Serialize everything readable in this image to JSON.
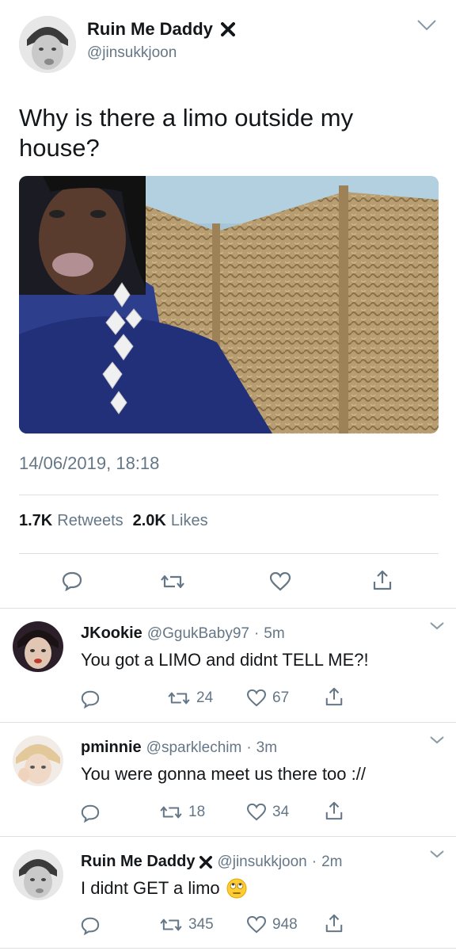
{
  "tweet": {
    "name": "Ruin Me Daddy",
    "handle": "@jinsukkjoon",
    "text": "Why is there a limo outside my house?",
    "timestamp": "14/06/2019, 18:18",
    "retweets_count": "1.7K",
    "retweets_label": "Retweets",
    "likes_count": "2.0K",
    "likes_label": "Likes"
  },
  "replies": [
    {
      "name": "JKookie",
      "handle": "@GgukBaby97",
      "time": "5m",
      "text": "You got a LIMO and didnt TELL ME?!",
      "retweets": "24",
      "likes": "67"
    },
    {
      "name": "pminnie",
      "handle": "@sparklechim",
      "time": "3m",
      "text": "You were gonna meet us there too ://",
      "retweets": "18",
      "likes": "34"
    },
    {
      "name": "Ruin Me Daddy",
      "handle": "@jinsukkjoon",
      "time": "2m",
      "text": "I didnt GET a limo",
      "retweets": "345",
      "likes": "948"
    }
  ],
  "icons": {
    "badge": "x-icon",
    "menu": "chevron-down-icon",
    "reply": "reply-icon",
    "retweet": "retweet-icon",
    "like": "heart-icon",
    "share": "share-icon",
    "emoji": "eye-roll-emoji"
  },
  "separator": "·",
  "colors": {
    "muted": "#657786",
    "divider": "#d9e1e6",
    "text": "#14171a"
  }
}
